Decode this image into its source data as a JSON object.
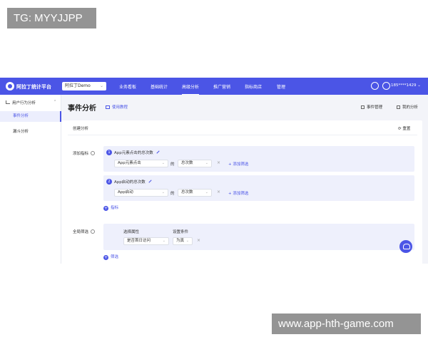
{
  "watermarks": {
    "top": "TG: MYYJJPP",
    "bottom": "www.app-hth-game.com"
  },
  "topnav": {
    "brand": "阿拉丁统计平台",
    "project": "阿拉丁Demo",
    "items": [
      "业务看板",
      "基础统计",
      "高级分析",
      "推广营销",
      "指标商店",
      "管理"
    ],
    "active_index": 2,
    "user": "185****1429"
  },
  "sidebar": {
    "group": "用户行为分析",
    "items": [
      "事件分析",
      "漏斗分析"
    ],
    "active_index": 0
  },
  "header": {
    "title": "事件分析",
    "help": "使用教程",
    "event_manage": "事件管理",
    "my_analysis": "我的分析"
  },
  "card": {
    "create": "创建分析",
    "reset": "重置",
    "add_metric_label": "添加指标",
    "metrics": [
      {
        "num": "1",
        "title": "App元素点击的总次数",
        "event": "App元素点击",
        "de": "的",
        "measure": "总次数",
        "add_filter": "添加筛选"
      },
      {
        "num": "2",
        "title": "App启动的总次数",
        "event": "App启动",
        "de": "的",
        "measure": "总次数",
        "add_filter": "添加筛选"
      }
    ],
    "add_metric_btn": "指标",
    "global_filter_label": "全局筛选",
    "filter": {
      "prop_label": "选择属性",
      "cond_label": "设置条件",
      "prop_value": "是否首日访问",
      "cond_value": "为真"
    },
    "add_filter_btn": "筛选"
  },
  "colors": {
    "primary": "#4b55e6",
    "panel": "#eef0fc"
  }
}
